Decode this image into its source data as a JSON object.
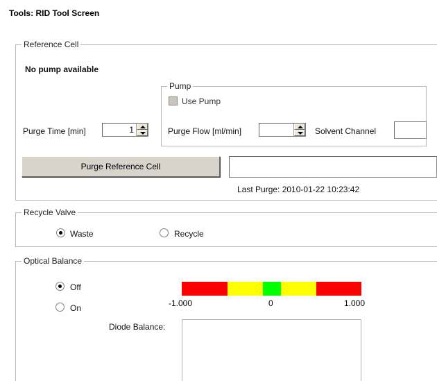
{
  "page": {
    "title": "Tools: RID Tool Screen"
  },
  "reference_cell": {
    "legend": "Reference Cell",
    "status": "No pump available",
    "purge_time_label": "Purge Time [min]",
    "purge_time_value": "1",
    "purge_button": "Purge Reference Cell",
    "last_purge": "Last Purge: 2010-01-22 10:23:42"
  },
  "pump": {
    "legend": "Pump",
    "use_pump_label": "Use Pump",
    "use_pump_checked": false,
    "purge_flow_label": "Purge Flow [ml/min]",
    "purge_flow_value": "",
    "solvent_channel_label": "Solvent Channel",
    "solvent_channel_value": ""
  },
  "recycle_valve": {
    "legend": "Recycle Valve",
    "options": [
      {
        "label": "Waste",
        "selected": true
      },
      {
        "label": "Recycle",
        "selected": false
      }
    ]
  },
  "optical_balance": {
    "legend": "Optical Balance",
    "options": [
      {
        "label": "Off",
        "selected": true
      },
      {
        "label": "On",
        "selected": false
      }
    ],
    "scale_min": "-1.000",
    "scale_mid": "0",
    "scale_max": "1.000",
    "diode_balance_label": "Diode Balance:",
    "colors": {
      "red": "#ff0000",
      "yellow": "#ffff00",
      "green": "#00ff00"
    }
  }
}
